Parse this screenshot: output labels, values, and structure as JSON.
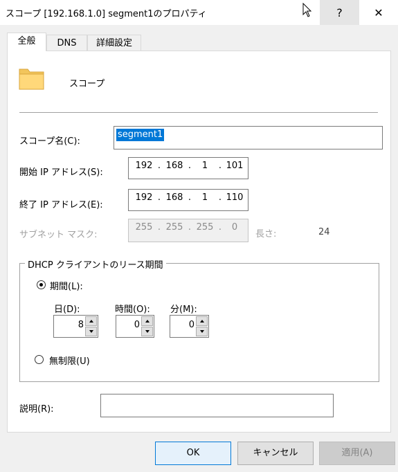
{
  "window": {
    "title": "スコープ [192.168.1.0] segment1のプロパティ",
    "help_label": "?",
    "close_label": "✕"
  },
  "tabs": [
    {
      "label": "全般",
      "active": true
    },
    {
      "label": "DNS",
      "active": false
    },
    {
      "label": "詳細設定",
      "active": false
    }
  ],
  "header": {
    "icon": "folder-icon",
    "type_label": "スコープ"
  },
  "form": {
    "scope_name_label": "スコープ名(C):",
    "scope_name_value": "segment1",
    "start_ip_label": "開始 IP アドレス(S):",
    "start_ip": [
      "192",
      "168",
      "1",
      "101"
    ],
    "end_ip_label": "終了 IP アドレス(E):",
    "end_ip": [
      "192",
      "168",
      "1",
      "110"
    ],
    "subnet_label": "サブネット マスク:",
    "subnet_mask": [
      "255",
      "255",
      "255",
      "0"
    ],
    "length_label": "長さ:",
    "length_value": "24",
    "description_label": "説明(R):",
    "description_value": ""
  },
  "lease": {
    "group_title": "DHCP クライアントのリース期間",
    "limited_label": "期間(L):",
    "limited_selected": true,
    "days_label": "日(D):",
    "days_value": "8",
    "hours_label": "時間(O):",
    "hours_value": "0",
    "minutes_label": "分(M):",
    "minutes_value": "0",
    "unlimited_label": "無制限(U)",
    "unlimited_selected": false
  },
  "buttons": {
    "ok": "OK",
    "cancel": "キャンセル",
    "apply": "適用(A)"
  },
  "colors": {
    "selection": "#0078d7",
    "dialog_bg": "#f0f0f0",
    "panel_bg": "#ffffff"
  }
}
